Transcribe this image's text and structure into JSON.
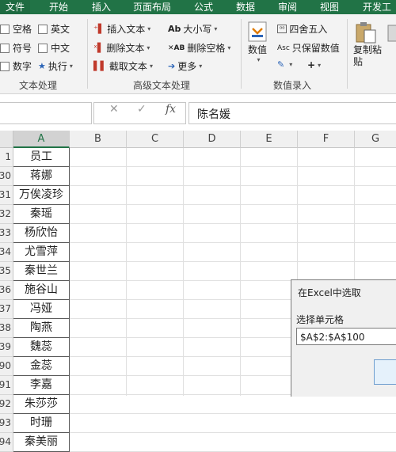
{
  "ribbon_tabs": [
    "文件",
    "开始",
    "插入",
    "页面布局",
    "公式",
    "数据",
    "审阅",
    "视图",
    "开发工"
  ],
  "groups": {
    "text_process": {
      "label": "文本处理",
      "items": [
        "空格",
        "英文",
        "符号",
        "中文",
        "数字",
        "执行"
      ]
    },
    "advanced_text": {
      "label": "高级文本处理",
      "items": [
        "插入文本",
        "大小写",
        "删除文本",
        "删除空格",
        "截取文本",
        "更多"
      ]
    },
    "number_entry": {
      "label": "数值录入",
      "numeric": "数值",
      "round": "四舍五入",
      "keep_values": "只保留数值",
      "plus": "+",
      "copy_paste": "复制粘贴"
    }
  },
  "formula_bar": {
    "cancel": "✕",
    "confirm": "✓",
    "fx": "fx",
    "content": "陈名媛"
  },
  "columns": [
    "A",
    "B",
    "C",
    "D",
    "E",
    "F",
    "G"
  ],
  "rows": [
    {
      "num": "1",
      "value": "员工"
    },
    {
      "num": "30",
      "value": "蒋娜"
    },
    {
      "num": "31",
      "value": "万俟凌珍"
    },
    {
      "num": "32",
      "value": "秦瑶"
    },
    {
      "num": "33",
      "value": "杨欣怡"
    },
    {
      "num": "34",
      "value": "尤雪萍"
    },
    {
      "num": "35",
      "value": "秦世兰"
    },
    {
      "num": "36",
      "value": "施谷山"
    },
    {
      "num": "37",
      "value": "冯娅"
    },
    {
      "num": "38",
      "value": "陶燕"
    },
    {
      "num": "39",
      "value": "魏蕊"
    },
    {
      "num": "90",
      "value": "金蕊"
    },
    {
      "num": "91",
      "value": "李嘉"
    },
    {
      "num": "92",
      "value": "朱莎莎"
    },
    {
      "num": "93",
      "value": "时珊"
    },
    {
      "num": "94",
      "value": "秦美丽"
    }
  ],
  "dialog": {
    "title": "在Excel中选取",
    "label": "选择单元格",
    "range_value": "$A$2:$A$100"
  },
  "colors": {
    "ribbon_green": "#217346",
    "ribbon_bg": "#f3f3f3"
  }
}
